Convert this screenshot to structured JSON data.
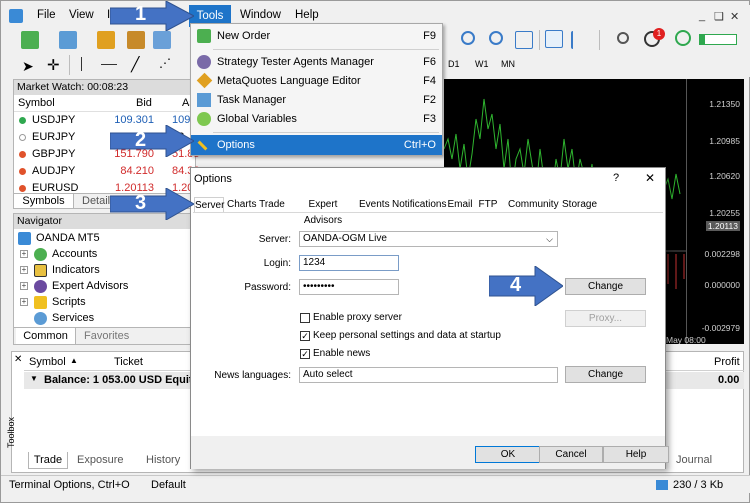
{
  "menubar": {
    "items": [
      "File",
      "View",
      "I",
      "Tools",
      "Window",
      "Help"
    ],
    "window_controls": [
      "_",
      "❑",
      "✕"
    ]
  },
  "toolbar2": {
    "timeframes": [
      "D1",
      "W1",
      "MN"
    ],
    "notification_count": "1"
  },
  "market_watch": {
    "title": "Market Watch: 00:08:23",
    "columns": [
      "Symbol",
      "Bid",
      "As"
    ],
    "rows": [
      {
        "symbol": "USDJPY",
        "bid": "109.301",
        "ask": "109.36",
        "color": "#1e5fb5",
        "marker": "#2fa84f"
      },
      {
        "symbol": "EURJPY",
        "bid": "",
        "ask": "38",
        "color": "#000000",
        "marker": "#9a9a9a"
      },
      {
        "symbol": "GBPJPY",
        "bid": "151.790",
        "ask": "51.85",
        "color": "#d12b2b",
        "marker": "#e0522b"
      },
      {
        "symbol": "AUDJPY",
        "bid": "84.210",
        "ask": "84.36",
        "color": "#d12b2b",
        "marker": "#e0522b"
      },
      {
        "symbol": "EURUSD",
        "bid": "1.20113",
        "ask": "1.2016",
        "color": "#d12b2b",
        "marker": "#e0522b"
      }
    ],
    "tabs": [
      "Symbols",
      "Details"
    ]
  },
  "navigator": {
    "title": "Navigator",
    "root": "OANDA MT5",
    "items": [
      "Accounts",
      "Indicators",
      "Expert Advisors",
      "Scripts",
      "Services"
    ],
    "tabs": [
      "Common",
      "Favorites"
    ]
  },
  "chart": {
    "prices": [
      "1.21350",
      "1.20985",
      "1.20620",
      "1.20255",
      "1.20113",
      "0.002298",
      "0.000000",
      "-0.002979"
    ],
    "time_label": "May 08:00"
  },
  "dropdown": {
    "items": [
      {
        "label": "New Order",
        "shortcut": "F9"
      },
      {
        "label": "Strategy Tester Agents Manager",
        "shortcut": "F6"
      },
      {
        "label": "MetaQuotes Language Editor",
        "shortcut": "F4"
      },
      {
        "label": "Task Manager",
        "shortcut": "F2"
      },
      {
        "label": "Global Variables",
        "shortcut": "F3"
      },
      {
        "label": "Options",
        "shortcut": "Ctrl+O"
      }
    ]
  },
  "dialog": {
    "title": "Options",
    "help": "?",
    "close": "✕",
    "tabs": [
      "Server",
      "Charts",
      "Trade",
      "Expert Advisors",
      "Events",
      "Notifications",
      "Email",
      "FTP",
      "Community",
      "Storage"
    ],
    "server_label": "Server:",
    "server_value": "OANDA-OGM Live",
    "login_label": "Login:",
    "login_value": "1234",
    "password_label": "Password:",
    "password_value": "•••••••••",
    "change_label": "Change",
    "proxy_label": "Proxy...",
    "checks": [
      {
        "label": "Enable proxy server",
        "checked": false
      },
      {
        "label": "Keep personal settings and data at startup",
        "checked": true
      },
      {
        "label": "Enable news",
        "checked": true
      }
    ],
    "news_lang_label": "News languages:",
    "news_lang_value": "Auto select",
    "change2_label": "Change",
    "ok": "OK",
    "cancel": "Cancel",
    "help_btn": "Help"
  },
  "terminal": {
    "columns": [
      "Symbol",
      "Ticket",
      "Profit"
    ],
    "balance": "Balance: 1 053.00 USD  Equity:",
    "profit_total": "0.00",
    "side_label": "Toolbox",
    "tabs": [
      "Trade",
      "Exposure",
      "History",
      "N"
    ],
    "journal_tab": "Journal"
  },
  "status": {
    "left": "Terminal Options, Ctrl+O",
    "profile": "Default",
    "traffic": "230 / 3 Kb"
  },
  "annotations": [
    "1",
    "2",
    "3",
    "4"
  ],
  "colors": {
    "accent": "#1e74c9",
    "arrow": "#4472c4",
    "chart_bg": "#000000",
    "candle": "#2fb52f"
  }
}
